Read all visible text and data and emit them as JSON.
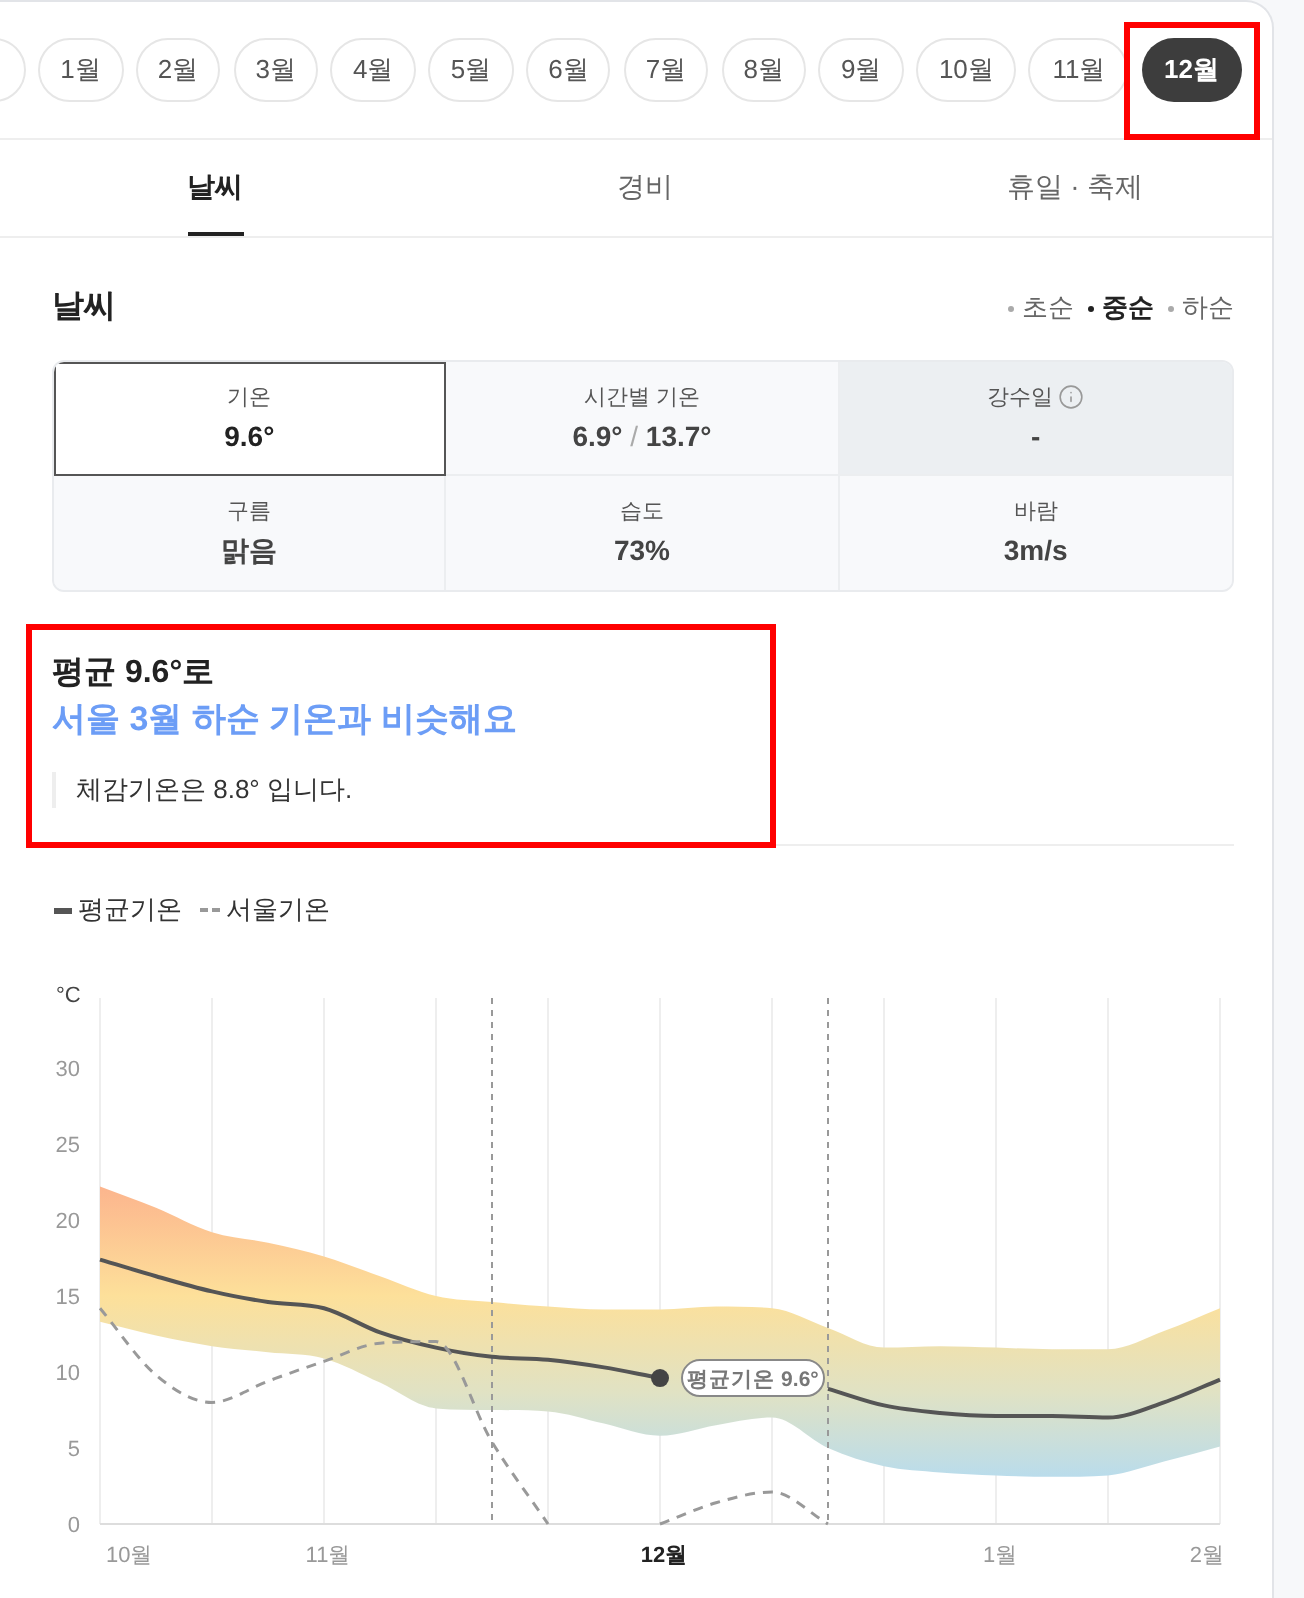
{
  "months": [
    {
      "label": "1월",
      "selected": false,
      "highlighted": false
    },
    {
      "label": "2월",
      "selected": false,
      "highlighted": false
    },
    {
      "label": "3월",
      "selected": false,
      "highlighted": false
    },
    {
      "label": "4월",
      "selected": false,
      "highlighted": false
    },
    {
      "label": "5월",
      "selected": false,
      "highlighted": false
    },
    {
      "label": "6월",
      "selected": false,
      "highlighted": false
    },
    {
      "label": "7월",
      "selected": false,
      "highlighted": false
    },
    {
      "label": "8월",
      "selected": false,
      "highlighted": false
    },
    {
      "label": "9월",
      "selected": false,
      "highlighted": false
    },
    {
      "label": "10월",
      "selected": false,
      "highlighted": false
    },
    {
      "label": "11월",
      "selected": false,
      "highlighted": false
    },
    {
      "label": "12월",
      "selected": true,
      "highlighted": true
    }
  ],
  "tabs": [
    {
      "label": "날씨",
      "selected": true
    },
    {
      "label": "경비",
      "selected": false
    },
    {
      "label": "휴일 · 축제",
      "selected": false
    }
  ],
  "weather": {
    "title": "날씨",
    "periods": [
      {
        "label": "초순",
        "selected": false
      },
      {
        "label": "중순",
        "selected": true
      },
      {
        "label": "하순",
        "selected": false
      }
    ],
    "cells": [
      {
        "kind": "single",
        "label": "기온",
        "value": "9.6°",
        "selected": true,
        "disabled": false,
        "info": false
      },
      {
        "kind": "range",
        "label": "시간별 기온",
        "low": "6.9°",
        "separator": "/",
        "high": "13.7°",
        "selected": false,
        "disabled": false,
        "info": false
      },
      {
        "kind": "single",
        "label": "강수일",
        "value": "-",
        "selected": false,
        "disabled": true,
        "info": true
      },
      {
        "kind": "single",
        "label": "구름",
        "value": "맑음",
        "selected": false,
        "disabled": false,
        "info": false
      },
      {
        "kind": "single",
        "label": "습도",
        "value": "73%",
        "selected": false,
        "disabled": false,
        "info": false
      },
      {
        "kind": "single",
        "label": "바람",
        "value": "3m/s",
        "selected": false,
        "disabled": false,
        "info": false
      }
    ]
  },
  "summary": {
    "title": "평균 9.6°로",
    "subtitle": "서울 3월 하순 기온과 비슷해요",
    "note": "체감기온은 8.8° 입니다.",
    "highlighted": true
  },
  "chart": {
    "chart_data": {
      "type": "line",
      "ylabel": "°C",
      "grid": true,
      "legend": true,
      "categories": [
        "10월",
        null,
        null,
        null,
        "11월",
        null,
        null,
        null,
        null,
        null,
        "12월",
        null,
        null,
        null,
        null,
        null,
        "1월",
        null,
        null,
        null,
        "2월"
      ],
      "ylim": [
        0,
        35
      ],
      "yticks": [
        0,
        5,
        10,
        15,
        20,
        25,
        30
      ],
      "series": [
        {
          "name": "평균기온",
          "color": "#555555",
          "line_style": "solid",
          "values": [
            17.4,
            16.3,
            15.3,
            14.6,
            14.2,
            12.6,
            11.6,
            11.0,
            10.8,
            10.3,
            9.6,
            null,
            null,
            8.9,
            7.8,
            7.3,
            7.1,
            7.1,
            7.0,
            8.0,
            9.5
          ]
        },
        {
          "name": "서울기온",
          "color": "#999999",
          "line_style": "dashed",
          "values": [
            14.2,
            9.8,
            8.0,
            9.4,
            10.7,
            11.9,
            12.0,
            5.4,
            0,
            null,
            0,
            1.4,
            2.1,
            0,
            null,
            null,
            null,
            null,
            null,
            null,
            null
          ]
        }
      ],
      "annotations": [
        {
          "x": "12월",
          "y": 9.6,
          "text": "평균기온 9.6°"
        }
      ]
    }
  }
}
